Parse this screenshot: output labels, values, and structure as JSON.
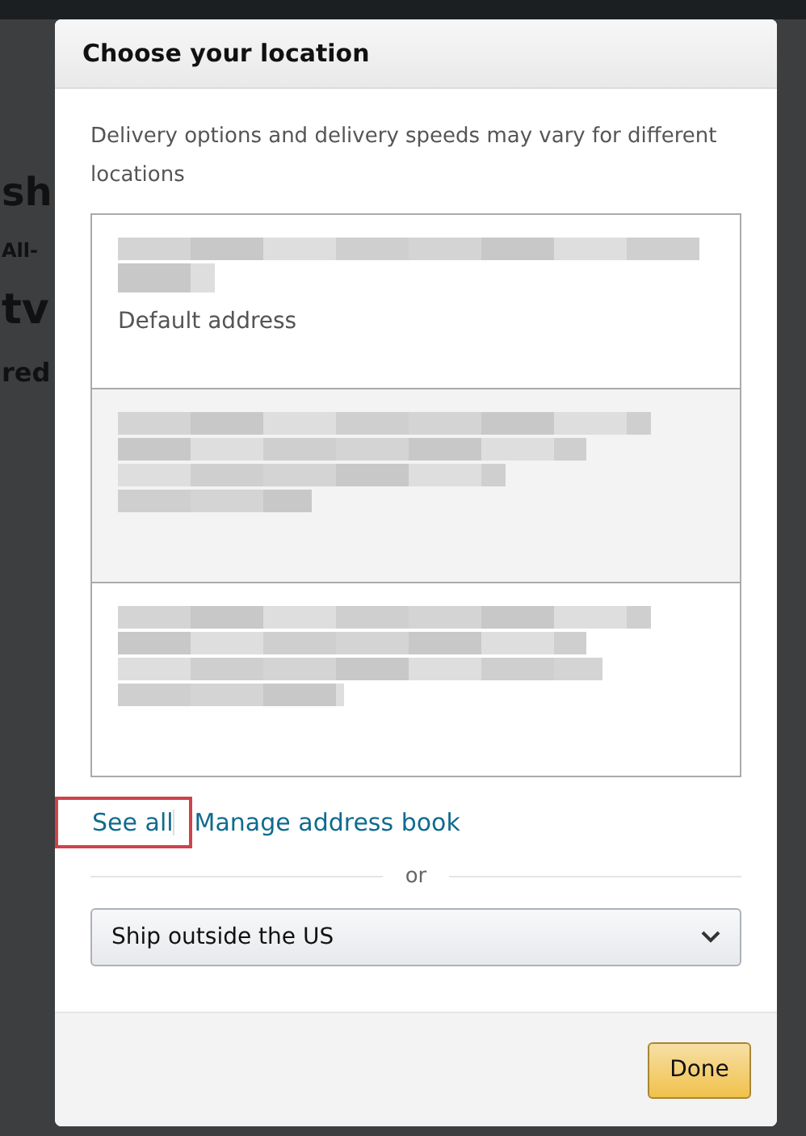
{
  "background_page": {
    "fragments": [
      "sh",
      "All-",
      "tv",
      "red"
    ]
  },
  "dialog": {
    "title": "Choose your location",
    "note": "Delivery options and delivery speeds may vary for different locations",
    "addresses": [
      {
        "label": "Default address",
        "selected": false
      },
      {
        "selected": true
      },
      {
        "selected": false
      }
    ],
    "links": [
      {
        "label": "See all",
        "highlighted": true
      },
      {
        "label": "Manage address book",
        "highlighted": false
      }
    ],
    "separator": "or",
    "country_select": {
      "value": "Ship outside the US"
    },
    "done_button": "Done"
  }
}
